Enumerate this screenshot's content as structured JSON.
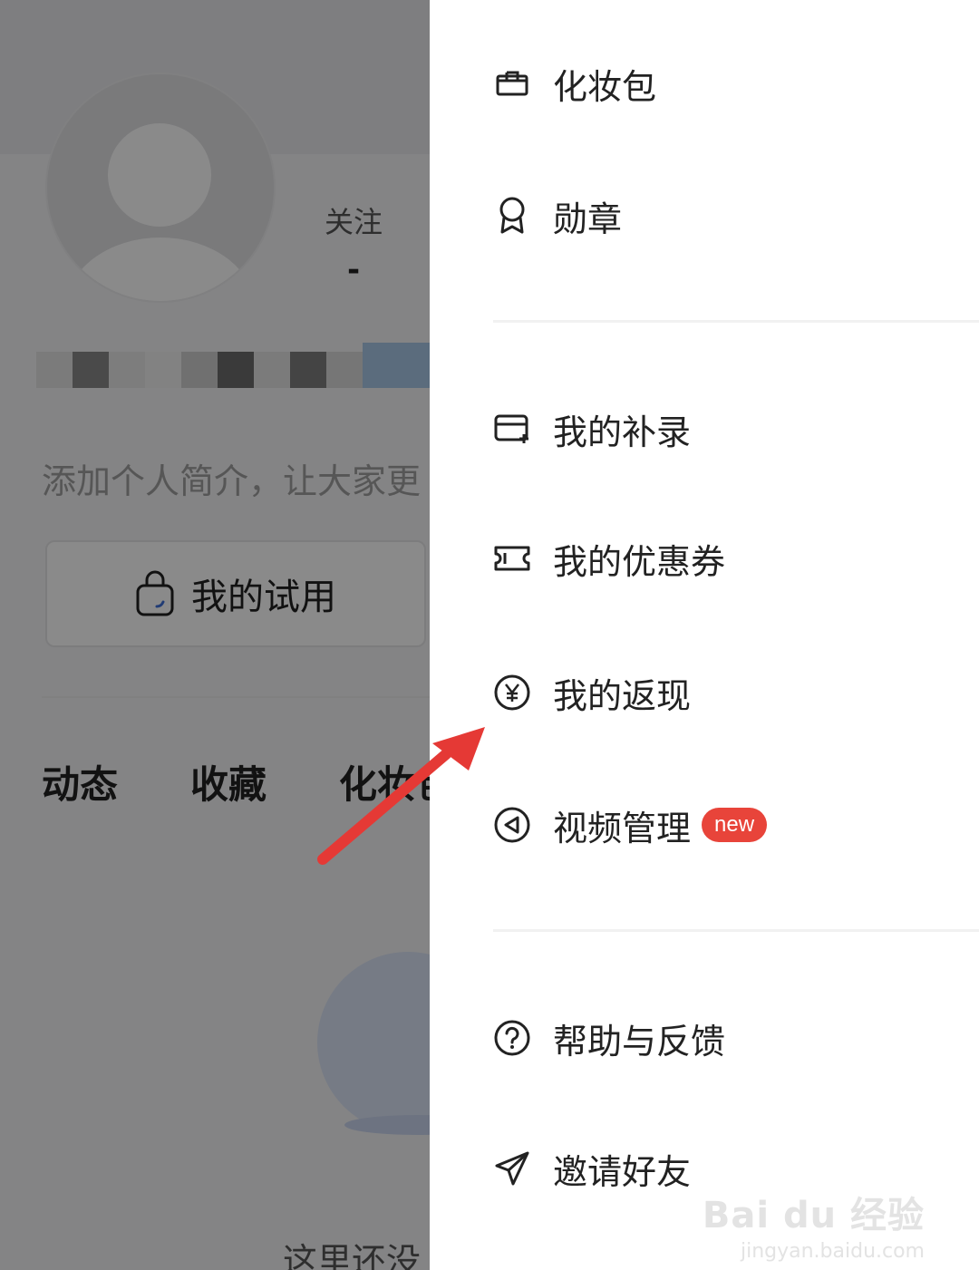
{
  "profile": {
    "follow_label": "关注",
    "follow_count": "-",
    "bio_placeholder": "添加个人简介，让大家更",
    "trial_label": "我的试用",
    "tabs": [
      {
        "label": "动态"
      },
      {
        "label": "收藏"
      },
      {
        "label": "化妆包"
      }
    ],
    "empty_text": "这里还没"
  },
  "drawer": {
    "section1": [
      {
        "label": "化妆包",
        "icon": "box-icon"
      },
      {
        "label": "勋章",
        "icon": "medal-icon"
      }
    ],
    "section2": [
      {
        "label": "我的补录",
        "icon": "card-add-icon"
      },
      {
        "label": "我的优惠券",
        "icon": "ticket-icon"
      },
      {
        "label": "我的返现",
        "icon": "yen-circle-icon"
      },
      {
        "label": "视频管理",
        "icon": "play-circle-icon",
        "badge": "new"
      }
    ],
    "section3": [
      {
        "label": "帮助与反馈",
        "icon": "help-circle-icon"
      },
      {
        "label": "邀请好友",
        "icon": "paper-plane-icon"
      }
    ]
  },
  "watermark": {
    "brand": "Bai du 经验",
    "url": "jingyan.baidu.com"
  },
  "colors": {
    "badge": "#e8443a",
    "arrow": "#e53935",
    "overlay": "rgba(0,0,0,0.46)"
  }
}
